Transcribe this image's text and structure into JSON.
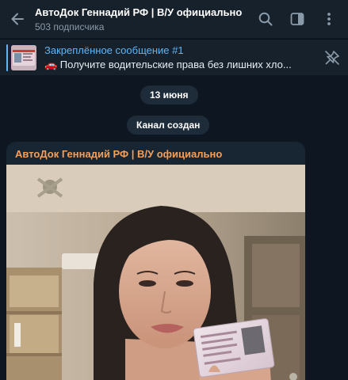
{
  "header": {
    "title": "АвтоДок Геннадий РФ | В/У официально",
    "subtitle": "503 подписчика",
    "icons": [
      "back-arrow-icon",
      "search-icon",
      "sidebar-toggle-icon",
      "more-vertical-icon"
    ]
  },
  "pinned": {
    "title": "Закреплённое сообщение #1",
    "text": "🚗 Получите водительские права без лишних хло...",
    "icon": "pin-off-icon"
  },
  "service": {
    "date": "13 июня",
    "created": "Канал создан"
  },
  "message": {
    "author": "АвтоДок Геннадий РФ | В/У официально",
    "photo_alt": "photo"
  },
  "colors": {
    "header_bg": "#17212b",
    "chat_bg": "#0e1621",
    "accent_blue": "#5eb5f7",
    "author_orange": "#f5a05a",
    "bubble_bg": "#182533"
  }
}
